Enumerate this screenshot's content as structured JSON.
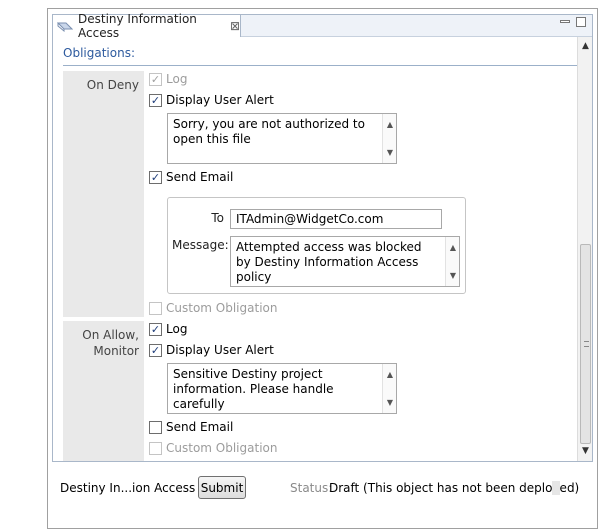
{
  "tab": {
    "title": "Destiny Information Access",
    "close_glyph": "⊠"
  },
  "obligations": {
    "title": "Obligations:",
    "on_deny": {
      "label": "On Deny",
      "log": {
        "label": "Log",
        "checked": true,
        "disabled": true
      },
      "display_user_alert": {
        "label": "Display User Alert",
        "checked": true
      },
      "alert_text": "Sorry, you are not authorized to open this file",
      "send_email": {
        "label": "Send Email",
        "checked": true
      },
      "email": {
        "to_label": "To",
        "to_value": "ITAdmin@WidgetCo.com",
        "message_label": "Message:",
        "message_value": "Attempted access was blocked by Destiny Information Access policy"
      },
      "custom_obligation": {
        "label": "Custom Obligation",
        "checked": false,
        "disabled": true
      }
    },
    "on_allow": {
      "label_line1": "On Allow,",
      "label_line2": "Monitor",
      "log": {
        "label": "Log",
        "checked": true
      },
      "display_user_alert": {
        "label": "Display User Alert",
        "checked": true
      },
      "alert_text": "Sensitive Destiny project information. Please handle carefully",
      "send_email": {
        "label": "Send Email",
        "checked": false
      },
      "custom_obligation": {
        "label": "Custom Obligation",
        "checked": false,
        "disabled": true
      }
    }
  },
  "status_bar": {
    "name": "Destiny In...ion Access",
    "submit_label": "Submit",
    "status_label": "Status:",
    "status_value": "Draft (This object has not been deployed)"
  },
  "icons": {
    "tab_icon": "policy-icon",
    "minimize": "minimize-icon",
    "maximize": "maximize-icon",
    "scroll_up": "scroll-up-arrow-icon",
    "scroll_down": "scroll-down-arrow-icon"
  }
}
